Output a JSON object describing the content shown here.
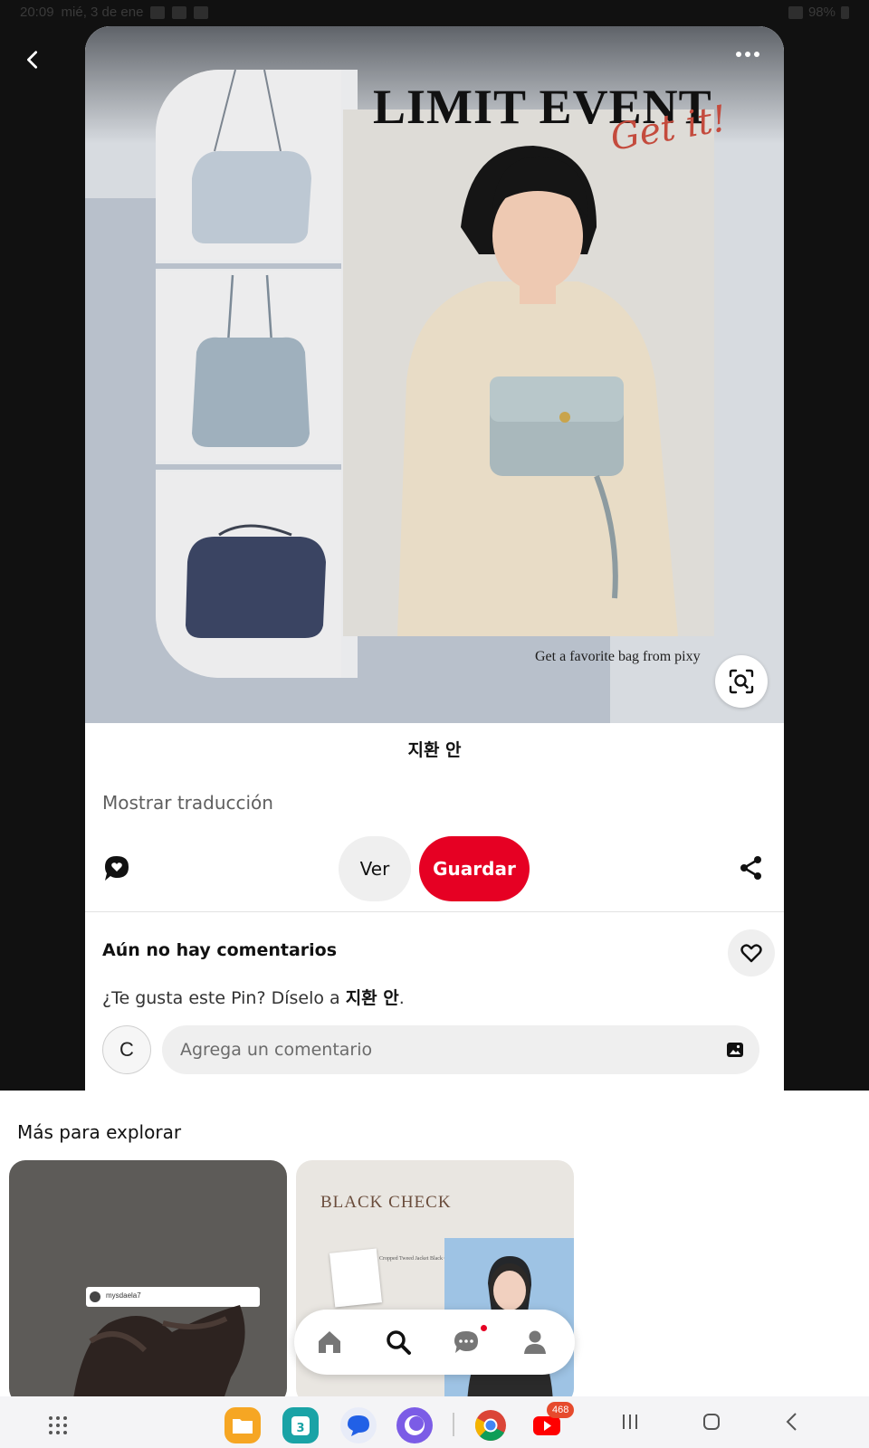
{
  "status_bar": {
    "time": "20:09",
    "date": "mié, 3 de ene",
    "battery": "98%"
  },
  "pin": {
    "headline": "LIMIT EVENT",
    "script_text": "Get it!",
    "tagline": "Get a favorite bag from pixy",
    "author": "지환 안",
    "translate_label": "Mostrar traducción"
  },
  "actions": {
    "view_label": "Ver",
    "save_label": "Guardar"
  },
  "comments": {
    "heading": "Aún no hay comentarios",
    "prompt_prefix": "¿Te gusta este Pin? Díselo a ",
    "prompt_name": "지환 안",
    "prompt_suffix": ".",
    "avatar_letter": "C",
    "input_placeholder": "Agrega un comentario"
  },
  "explore": {
    "title": "Más para explorar",
    "tiles": [
      {
        "caption": "mysdaela7"
      },
      {
        "caption": "BLACK CHECK",
        "sub": "Cropped Tweed Jacket Black Check"
      }
    ]
  },
  "system_nav": {
    "youtube_badge": "468",
    "calendar_day": "3"
  },
  "colors": {
    "accent": "#e60023",
    "badge": "#e64a2d"
  }
}
